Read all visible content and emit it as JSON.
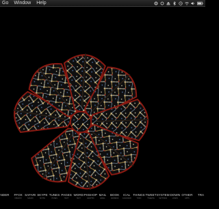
{
  "menubar": {
    "menus": [
      "Go",
      "Window",
      "Help"
    ]
  },
  "status_icons": [
    "gear-icon",
    "sync-icon",
    "eject-icon",
    "bluetooth-icon",
    "timemachine-icon",
    "wifi-icon",
    "volume-icon",
    "battery-icon"
  ],
  "desktop": {
    "wallpaper": "rose-window-stained-glass"
  },
  "colors": {
    "background": "#000000",
    "glass_red": "#8a1a12",
    "glass_gold": "#c8a048",
    "glass_blue": "#3c5a8a",
    "dock_text": "#d0d0d0"
  },
  "dock": {
    "items": [
      {
        "label": "NDER",
        "sublabel": ""
      },
      {
        "label": "FFOX",
        "sublabel": "FIREFOX"
      },
      {
        "label": "SAFARI",
        "sublabel": "SAFARI"
      },
      {
        "label": "SKYPE",
        "sublabel": "SKYPE"
      },
      {
        "label": "TUNES",
        "sublabel": "ITUNES"
      },
      {
        "label": "PAGES",
        "sublabel": "TEXT"
      },
      {
        "label": "WORD",
        "sublabel": "TEXT"
      },
      {
        "label": "PHSHOP",
        "sublabel": "GRAPHIC"
      },
      {
        "label": "MAIL",
        "sublabel": "EMAIL"
      },
      {
        "label": "BOOK",
        "sublabel": "ADDRESS"
      },
      {
        "label": "ICAL",
        "sublabel": "CALENDAR"
      },
      {
        "label": "THINGS",
        "sublabel": "TODO"
      },
      {
        "label": "TWEET",
        "sublabel": "TWEETIE"
      },
      {
        "label": "SYSTEM",
        "sublabel": "SETTINGS"
      },
      {
        "label": "DOWN",
        "sublabel": "LOADS"
      },
      {
        "label": "OTHER",
        "sublabel": "APPS"
      },
      {
        "label": "TRA",
        "sublabel": ""
      }
    ]
  }
}
